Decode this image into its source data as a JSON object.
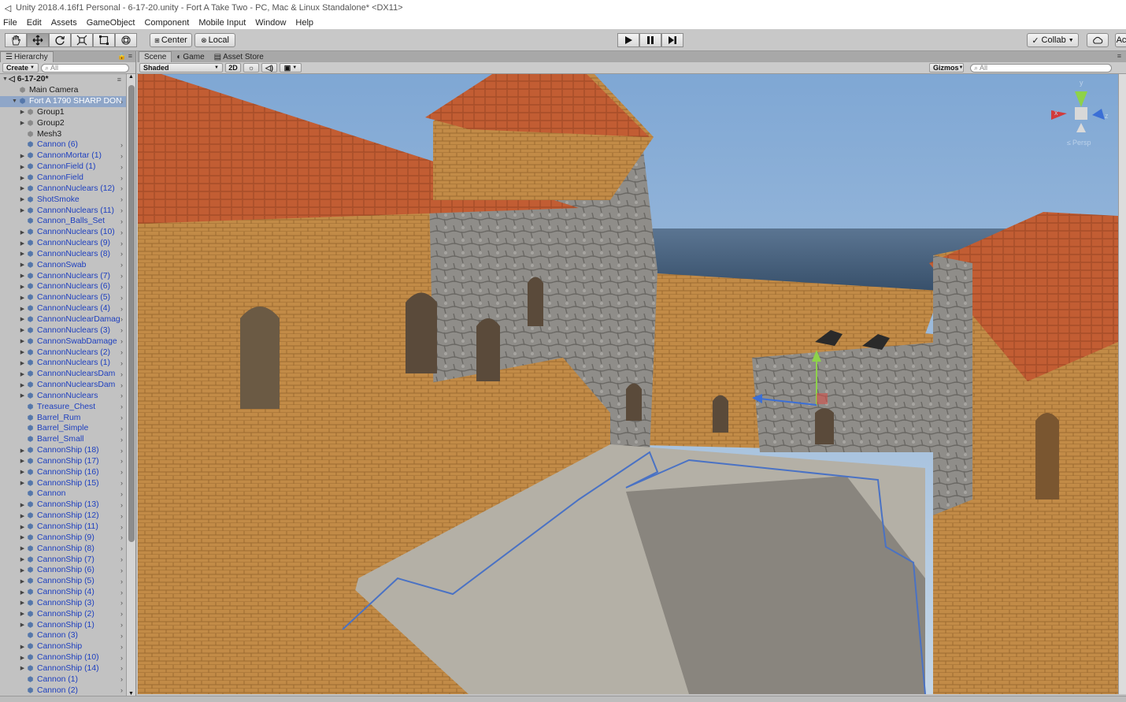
{
  "window": {
    "title": "Unity 2018.4.16f1 Personal - 6-17-20.unity - Fort A Take Two - PC, Mac & Linux Standalone* <DX11>"
  },
  "menu": [
    "File",
    "Edit",
    "Assets",
    "GameObject",
    "Component",
    "Mobile Input",
    "Window",
    "Help"
  ],
  "toolbar": {
    "tools": [
      "hand-icon",
      "move-icon",
      "rotate-icon",
      "scale-icon",
      "rect-icon",
      "transform-icon"
    ],
    "pivot_label": "Center",
    "space_label": "Local",
    "collab_label": "Collab",
    "account_label": "Ac"
  },
  "hierarchy": {
    "tab_label": "Hierarchy",
    "create_label": "Create",
    "search_placeholder": "All",
    "scene_name": "6-17-20*",
    "rows": [
      {
        "label": "Main Camera",
        "depth": 1,
        "arrow": false,
        "prefab": false
      },
      {
        "label": "Fort A 1790 SHARP DON",
        "depth": 1,
        "arrow": true,
        "expanded": true,
        "prefab": true,
        "selected": true
      },
      {
        "label": "Group1",
        "depth": 2,
        "arrow": true,
        "prefab": false
      },
      {
        "label": "Group2",
        "depth": 2,
        "arrow": true,
        "prefab": false
      },
      {
        "label": "Mesh3",
        "depth": 2,
        "arrow": false,
        "prefab": false
      },
      {
        "label": "Cannon (6)",
        "depth": 2,
        "arrow": false,
        "prefab": true
      },
      {
        "label": "CannonMortar (1)",
        "depth": 2,
        "arrow": true,
        "prefab": true
      },
      {
        "label": "CannonField (1)",
        "depth": 2,
        "arrow": true,
        "prefab": true
      },
      {
        "label": "CannonField",
        "depth": 2,
        "arrow": true,
        "prefab": true
      },
      {
        "label": "CannonNuclears (12)",
        "depth": 2,
        "arrow": true,
        "prefab": true
      },
      {
        "label": "ShotSmoke",
        "depth": 2,
        "arrow": true,
        "prefab": true
      },
      {
        "label": "CannonNuclears (11)",
        "depth": 2,
        "arrow": true,
        "prefab": true
      },
      {
        "label": "Cannon_Balls_Set",
        "depth": 2,
        "arrow": false,
        "prefab": true
      },
      {
        "label": "CannonNuclears (10)",
        "depth": 2,
        "arrow": true,
        "prefab": true
      },
      {
        "label": "CannonNuclears (9)",
        "depth": 2,
        "arrow": true,
        "prefab": true
      },
      {
        "label": "CannonNuclears (8)",
        "depth": 2,
        "arrow": true,
        "prefab": true
      },
      {
        "label": "CannonSwab",
        "depth": 2,
        "arrow": true,
        "prefab": true
      },
      {
        "label": "CannonNuclears (7)",
        "depth": 2,
        "arrow": true,
        "prefab": true
      },
      {
        "label": "CannonNuclears (6)",
        "depth": 2,
        "arrow": true,
        "prefab": true
      },
      {
        "label": "CannonNuclears (5)",
        "depth": 2,
        "arrow": true,
        "prefab": true
      },
      {
        "label": "CannonNuclears (4)",
        "depth": 2,
        "arrow": true,
        "prefab": true
      },
      {
        "label": "CannonNuclearDamag",
        "depth": 2,
        "arrow": true,
        "prefab": true
      },
      {
        "label": "CannonNuclears (3)",
        "depth": 2,
        "arrow": true,
        "prefab": true
      },
      {
        "label": "CannonSwabDamage",
        "depth": 2,
        "arrow": true,
        "prefab": true
      },
      {
        "label": "CannonNuclears (2)",
        "depth": 2,
        "arrow": true,
        "prefab": true
      },
      {
        "label": "CannonNuclears (1)",
        "depth": 2,
        "arrow": true,
        "prefab": true
      },
      {
        "label": "CannonNuclearsDam",
        "depth": 2,
        "arrow": true,
        "prefab": true
      },
      {
        "label": "CannonNuclearsDam",
        "depth": 2,
        "arrow": true,
        "prefab": true
      },
      {
        "label": "CannonNuclears",
        "depth": 2,
        "arrow": true,
        "prefab": true
      },
      {
        "label": "Treasure_Chest",
        "depth": 2,
        "arrow": false,
        "prefab": true
      },
      {
        "label": "Barrel_Rum",
        "depth": 2,
        "arrow": false,
        "prefab": true
      },
      {
        "label": "Barrel_Simple",
        "depth": 2,
        "arrow": false,
        "prefab": true
      },
      {
        "label": "Barrel_Small",
        "depth": 2,
        "arrow": false,
        "prefab": true
      },
      {
        "label": "CannonShip (18)",
        "depth": 2,
        "arrow": true,
        "prefab": true
      },
      {
        "label": "CannonShip (17)",
        "depth": 2,
        "arrow": true,
        "prefab": true
      },
      {
        "label": "CannonShip (16)",
        "depth": 2,
        "arrow": true,
        "prefab": true
      },
      {
        "label": "CannonShip (15)",
        "depth": 2,
        "arrow": true,
        "prefab": true
      },
      {
        "label": "Cannon",
        "depth": 2,
        "arrow": false,
        "prefab": true
      },
      {
        "label": "CannonShip (13)",
        "depth": 2,
        "arrow": true,
        "prefab": true
      },
      {
        "label": "CannonShip (12)",
        "depth": 2,
        "arrow": true,
        "prefab": true
      },
      {
        "label": "CannonShip (11)",
        "depth": 2,
        "arrow": true,
        "prefab": true
      },
      {
        "label": "CannonShip (9)",
        "depth": 2,
        "arrow": true,
        "prefab": true
      },
      {
        "label": "CannonShip (8)",
        "depth": 2,
        "arrow": true,
        "prefab": true
      },
      {
        "label": "CannonShip (7)",
        "depth": 2,
        "arrow": true,
        "prefab": true
      },
      {
        "label": "CannonShip (6)",
        "depth": 2,
        "arrow": true,
        "prefab": true
      },
      {
        "label": "CannonShip (5)",
        "depth": 2,
        "arrow": true,
        "prefab": true
      },
      {
        "label": "CannonShip (4)",
        "depth": 2,
        "arrow": true,
        "prefab": true
      },
      {
        "label": "CannonShip (3)",
        "depth": 2,
        "arrow": true,
        "prefab": true
      },
      {
        "label": "CannonShip (2)",
        "depth": 2,
        "arrow": true,
        "prefab": true
      },
      {
        "label": "CannonShip (1)",
        "depth": 2,
        "arrow": true,
        "prefab": true
      },
      {
        "label": "Cannon (3)",
        "depth": 2,
        "arrow": false,
        "prefab": true
      },
      {
        "label": "CannonShip",
        "depth": 2,
        "arrow": true,
        "prefab": true
      },
      {
        "label": "CannonShip (10)",
        "depth": 2,
        "arrow": true,
        "prefab": true
      },
      {
        "label": "CannonShip (14)",
        "depth": 2,
        "arrow": true,
        "prefab": true
      },
      {
        "label": "Cannon (1)",
        "depth": 2,
        "arrow": false,
        "prefab": true
      },
      {
        "label": "Cannon (2)",
        "depth": 2,
        "arrow": false,
        "prefab": true
      }
    ]
  },
  "scene": {
    "tabs": [
      "Scene",
      "Game",
      "Asset Store"
    ],
    "shading_mode": "Shaded",
    "mode_2d": "2D",
    "gizmos_label": "Gizmos",
    "search_placeholder": "All",
    "persp_label": "Persp",
    "axis_labels": {
      "y": "y",
      "x": "x",
      "z": "z"
    }
  },
  "colors": {
    "sky": "#8fb3da",
    "sea": "#3f5a7a",
    "roof": "#c25d33",
    "brick": "#c08a45",
    "stone": "#8c8a86",
    "ground": "#a8a49a",
    "prefab_text": "#1d3fbf"
  }
}
